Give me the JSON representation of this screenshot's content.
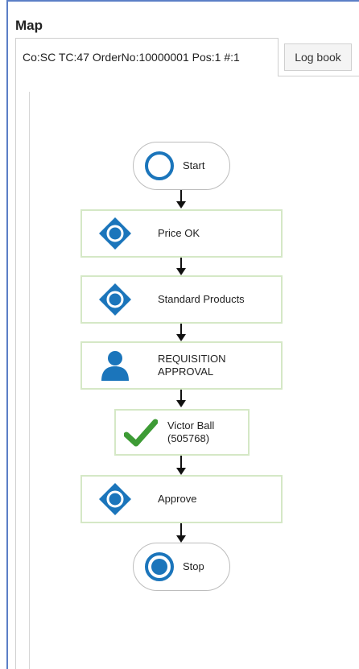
{
  "panel": {
    "title": "Map"
  },
  "tabs": [
    {
      "label": "Co:SC TC:47 OrderNo:10000001 Pos:1 #:1",
      "active": true
    },
    {
      "label": "Log book",
      "active": false
    }
  ],
  "workflow": {
    "nodes": [
      {
        "id": "start",
        "label": "Start",
        "icon": "start-circle-icon"
      },
      {
        "id": "price-ok",
        "label": "Price OK",
        "icon": "diamond-decision-icon"
      },
      {
        "id": "standard-products",
        "label": "Standard Products",
        "icon": "diamond-decision-icon"
      },
      {
        "id": "requisition-approval",
        "label": "REQUISITION\nAPPROVAL",
        "icon": "user-icon"
      },
      {
        "id": "victor-ball",
        "label": "Victor Ball\n(505768)",
        "icon": "checkmark-icon"
      },
      {
        "id": "approve",
        "label": "Approve",
        "icon": "diamond-decision-icon"
      },
      {
        "id": "stop",
        "label": "Stop",
        "icon": "stop-circle-icon"
      }
    ]
  },
  "colors": {
    "accent_blue": "#1b75bb",
    "check_green": "#3d9b35",
    "node_border": "#d5e8c6",
    "frame_blue": "#5b7fc6"
  }
}
